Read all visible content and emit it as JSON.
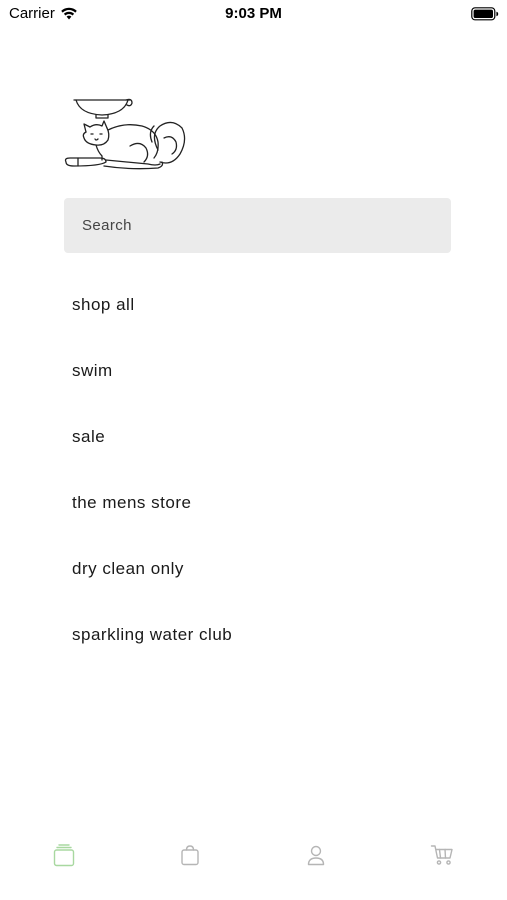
{
  "status_bar": {
    "carrier": "Carrier",
    "time": "9:03 PM"
  },
  "search": {
    "placeholder": "Search"
  },
  "menu": {
    "items": [
      {
        "label": "shop all"
      },
      {
        "label": "swim"
      },
      {
        "label": "sale"
      },
      {
        "label": "the mens store"
      },
      {
        "label": "dry clean only"
      },
      {
        "label": "sparkling water club"
      }
    ]
  },
  "tab_bar": {
    "active_color": "#a8d8a0",
    "inactive_color": "#b5b5b5",
    "tabs": [
      {
        "icon": "home-icon",
        "active": true
      },
      {
        "icon": "bag-icon",
        "active": false
      },
      {
        "icon": "person-icon",
        "active": false
      },
      {
        "icon": "cart-icon",
        "active": false
      }
    ]
  }
}
